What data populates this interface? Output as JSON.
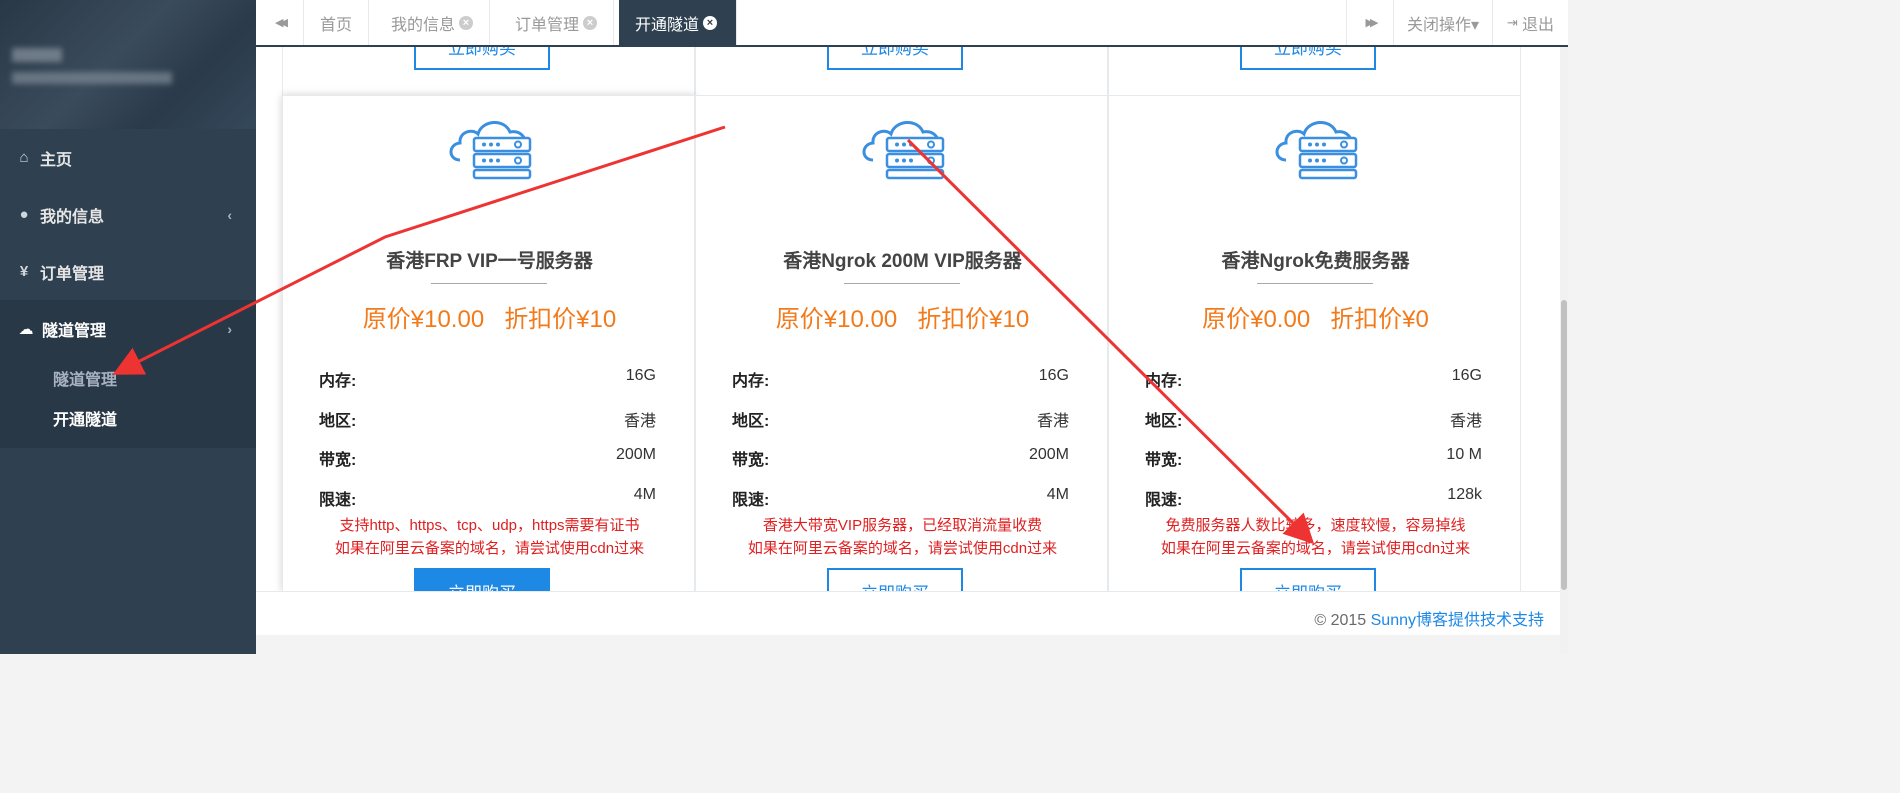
{
  "sidebar": {
    "items": [
      {
        "icon": "home-icon",
        "glyph": "⌂",
        "label": "主页"
      },
      {
        "icon": "user-icon",
        "glyph": "●",
        "label": "我的信息",
        "arrow": "‹"
      },
      {
        "icon": "yen-icon",
        "glyph": "¥",
        "label": "订单管理"
      },
      {
        "icon": "cloud-icon",
        "glyph": "☁",
        "label": "隧道管理",
        "arrow": "›"
      }
    ],
    "sub_items": [
      "隧道管理",
      "开通隧道"
    ]
  },
  "tabs": {
    "back_glyph": "◀◀",
    "forward_glyph": "▶▶",
    "items": [
      "首页",
      "我的信息",
      "订单管理",
      "开通隧道"
    ],
    "close_glyph": "×",
    "close_ops": "关闭操作▾",
    "logout": "退出"
  },
  "cards": [
    {
      "title": "香港FRP VIP一号服务器",
      "original_price": "原价¥10.00",
      "discount_price": "折扣价¥10",
      "specs": [
        {
          "k": "内存:",
          "v": "16G"
        },
        {
          "k": "地区:",
          "v": "香港"
        },
        {
          "k": "带宽:",
          "v": "200M"
        },
        {
          "k": "限速:",
          "v": "4M"
        }
      ],
      "note_lines": [
        "支持http、https、tcp、udp，https需要有证书",
        "如果在阿里云备案的域名，请尝试使用cdn过来"
      ],
      "button": "立即购买"
    },
    {
      "title": "香港Ngrok 200M VIP服务器",
      "original_price": "原价¥10.00",
      "discount_price": "折扣价¥10",
      "specs": [
        {
          "k": "内存:",
          "v": "16G"
        },
        {
          "k": "地区:",
          "v": "香港"
        },
        {
          "k": "带宽:",
          "v": "200M"
        },
        {
          "k": "限速:",
          "v": "4M"
        }
      ],
      "note_lines": [
        "香港大带宽VIP服务器，已经取消流量收费",
        "如果在阿里云备案的域名，请尝试使用cdn过来"
      ],
      "button": "立即购买"
    },
    {
      "title": "香港Ngrok免费服务器",
      "original_price": "原价¥0.00",
      "discount_price": "折扣价¥0",
      "specs": [
        {
          "k": "内存:",
          "v": "16G"
        },
        {
          "k": "地区:",
          "v": "香港"
        },
        {
          "k": "带宽:",
          "v": "10 M"
        },
        {
          "k": "限速:",
          "v": "128k"
        }
      ],
      "note_lines": [
        "免费服务器人数比较多，速度较慢，容易掉线",
        "如果在阿里云备案的域名，请尝试使用cdn过来"
      ],
      "button": "立即购买"
    }
  ],
  "footer": {
    "copyright": "© 2015 ",
    "link": "Sunny博客提供技术支持"
  },
  "colors": {
    "sidebar_bg": "#2f4050",
    "accent_blue": "#1e88e5",
    "price_orange": "#f27a1a",
    "note_red": "#e02020",
    "annotation_red": "#ee3333"
  }
}
